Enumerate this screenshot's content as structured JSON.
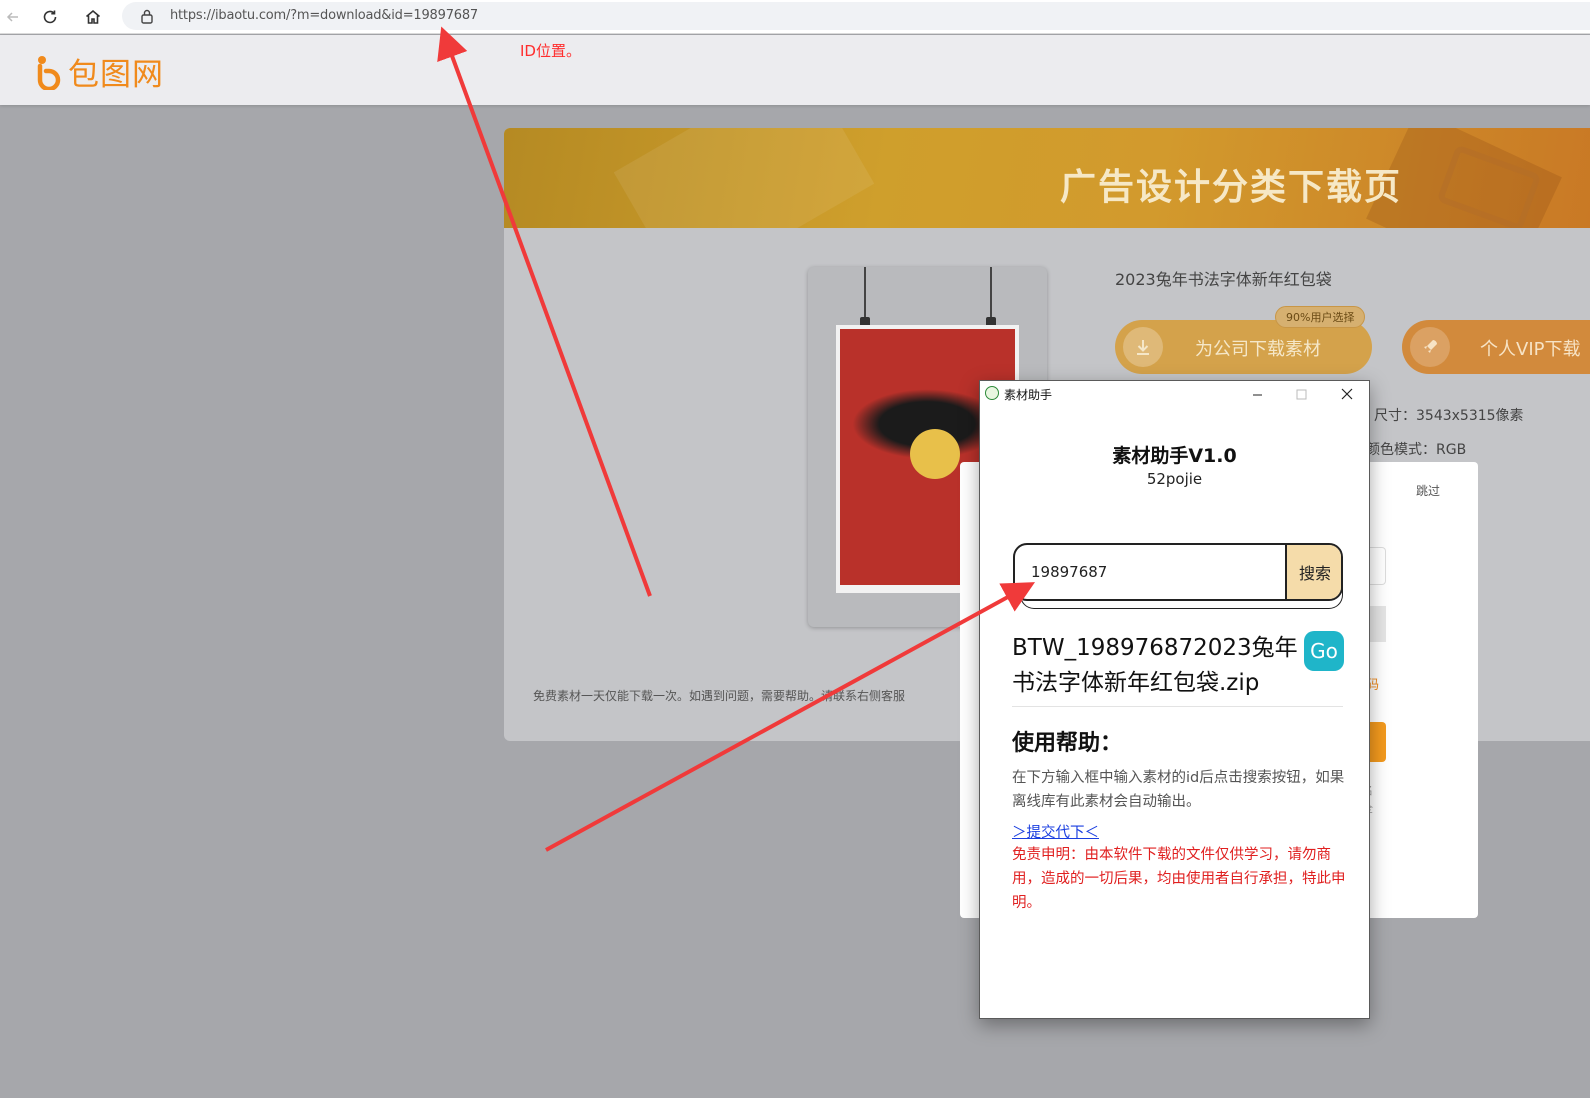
{
  "browser": {
    "url": "https://ibaotu.com/?m=download&id=19897687"
  },
  "site": {
    "logo_text": "包图网"
  },
  "annotation": {
    "id_note": "ID位置。"
  },
  "banner": {
    "title": "广告设计分类下载页"
  },
  "item": {
    "title": "2023兔年书法字体新年红包袋",
    "company_download_label": "为公司下载素材",
    "badge": "90%用户选择",
    "vip_download_label": "个人VIP下载",
    "size_label": "尺寸：3543x5315像素",
    "color_mode_label": "颜色模式：RGB",
    "footnote": "免费素材一天仅能下载一次。如遇到问题，需要帮助。请联系右侧客服"
  },
  "bg_panel": {
    "skip": "跳过",
    "link_fragment": "码",
    "note_line1": "名",
    "note_line2": "全"
  },
  "popup": {
    "window_title": "素材助手",
    "heading": "素材助手V1.0",
    "subheading": "52pojie",
    "search_value": "19897687",
    "search_button": "搜索",
    "file_name": "BTW_198976872023兔年书法字体新年红包袋.zip",
    "go_button": "Go",
    "help_title": "使用帮助：",
    "help_text": "在下方输入框中输入素材的id后点击搜索按钮，如果离线库有此素材会自动输出。",
    "submit_link": "＞提交代下＜",
    "disclaimer": "免责申明：由本软件下载的文件仅供学习，请勿商用，造成的一切后果，均由使用者自行承担，特此申明。"
  },
  "colors": {
    "accent_orange": "#f08a1c",
    "arrow_red": "#f03a3a",
    "go_teal": "#1fb5c9",
    "search_btn": "#f5dcaa",
    "disclaimer_red": "#e02020"
  }
}
